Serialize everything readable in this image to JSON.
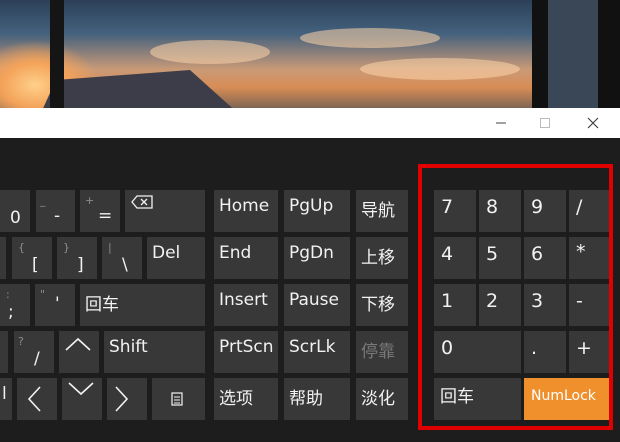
{
  "window": {
    "minimize_icon": "minimize-icon",
    "maximize_icon": "maximize-icon",
    "close_icon": "close-icon"
  },
  "keys": {
    "row1": {
      "zero": "0",
      "minus_top": "_",
      "minus_bottom": "-",
      "plus_top": "+",
      "equals_bottom": "=",
      "backspace_icon": "backspace-icon",
      "home": "Home",
      "pgup": "PgUp",
      "nav": "导航"
    },
    "row2": {
      "brace_top": "{",
      "bracket_bottom": "[",
      "closebrace_top": "}",
      "closebracket_bottom": "]",
      "pipe_top": "|",
      "backslash_bottom": "\\",
      "del": "Del",
      "end": "End",
      "pgdn": "PgDn",
      "moveup": "上移"
    },
    "row3": {
      "colon_top": ":",
      "semicolon_bottom": ";",
      "quote_top": "\"",
      "apostrophe_bottom": "'",
      "enter": "回车",
      "insert": "Insert",
      "pause": "Pause",
      "movedown": "下移"
    },
    "row4": {
      "question_top": "?",
      "slash_bottom": "/",
      "up_arrow": "^",
      "shift": "Shift",
      "prtscn": "PrtScn",
      "scrlk": "ScrLk",
      "dock": "停靠"
    },
    "row5": {
      "ctrl_partial": "l",
      "left_arrow": "<",
      "down_arrow": "v",
      "right_arrow": ">",
      "menu_icon": "menu-icon",
      "options": "选项",
      "help": "帮助",
      "fade": "淡化"
    },
    "numpad": {
      "n7": "7",
      "n8": "8",
      "n9": "9",
      "slash": "/",
      "n4": "4",
      "n5": "5",
      "n6": "6",
      "star": "*",
      "n1": "1",
      "n2": "2",
      "n3": "3",
      "minus": "-",
      "n0": "0",
      "dot": ".",
      "plus": "+",
      "enter": "回车",
      "numlock": "NumLock"
    }
  },
  "colors": {
    "key_bg": "#383838",
    "keyboard_bg": "#1d1d1d",
    "accent": "#f0902c",
    "highlight": "#e00000"
  }
}
